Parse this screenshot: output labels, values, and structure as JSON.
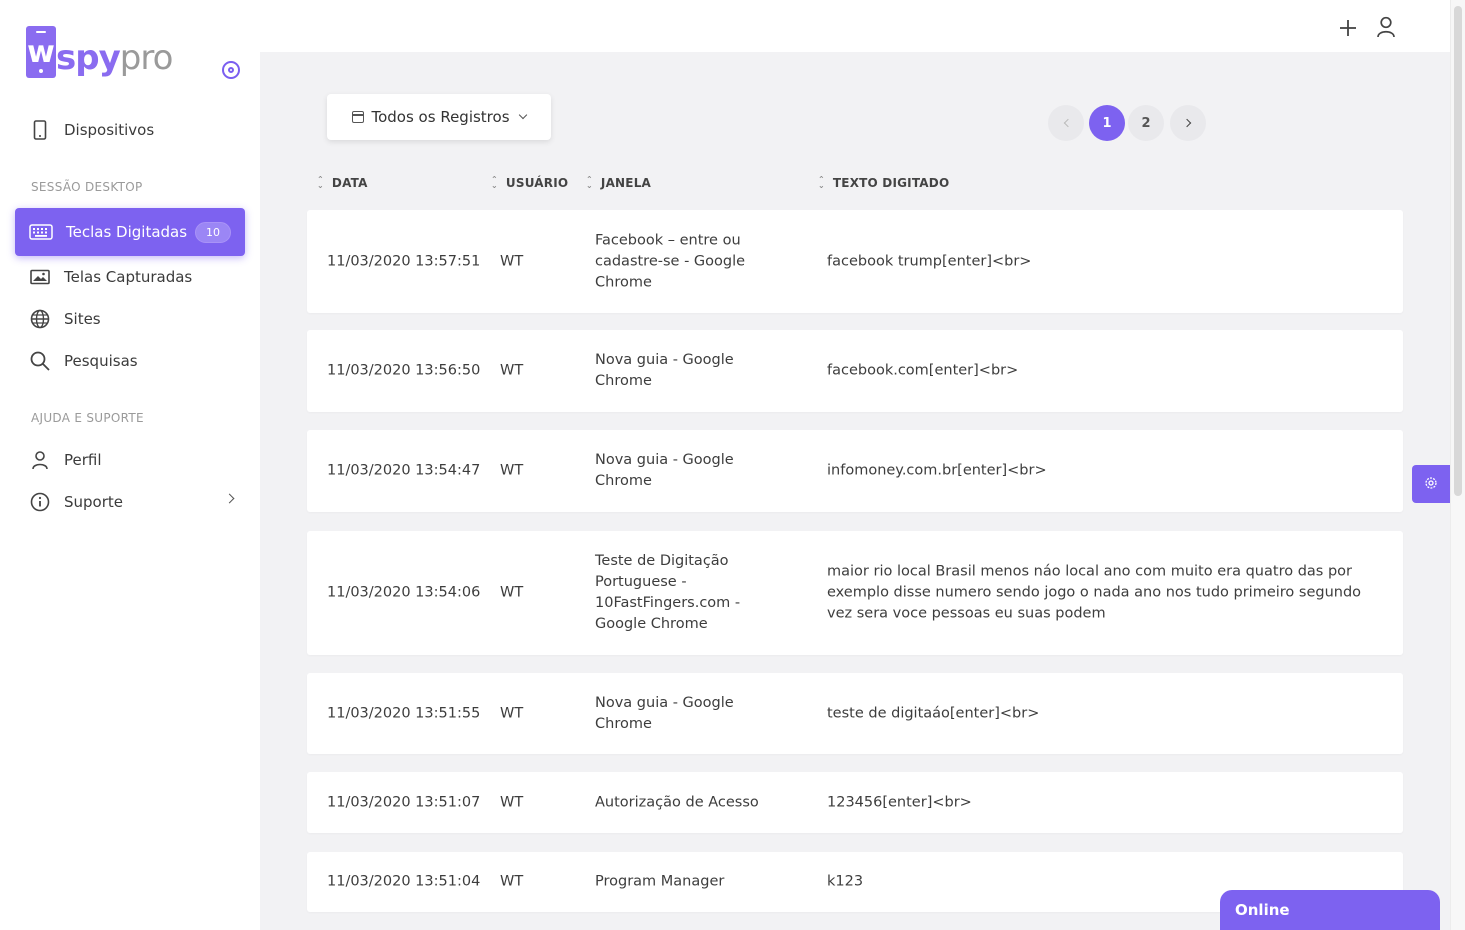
{
  "brand": {
    "mark": "w",
    "spy": "spy",
    "pro": "pro"
  },
  "sidebar": {
    "devices_label": "Dispositivos",
    "section_desktop": "SESSÃO DESKTOP",
    "keystrokes_label": "Teclas Digitadas",
    "keystrokes_count": "10",
    "screens_label": "Telas Capturadas",
    "sites_label": "Sites",
    "searches_label": "Pesquisas",
    "section_help": "AJUDA E SUPORTE",
    "profile_label": "Perfil",
    "support_label": "Suporte"
  },
  "filter": {
    "label": "Todos os Registros"
  },
  "pagination": {
    "pages": [
      "1",
      "2"
    ],
    "current": "1"
  },
  "table": {
    "headers": {
      "date": "DATA",
      "user": "USUÁRIO",
      "window": "JANELA",
      "text": "TEXTO DIGITADO"
    },
    "rows": [
      {
        "date": "11/03/2020 13:57:51",
        "user": "WT",
        "window": "Facebook – entre ou cadastre-se - Google Chrome",
        "text": "facebook trump[enter]<br>"
      },
      {
        "date": "11/03/2020 13:56:50",
        "user": "WT",
        "window": "Nova guia - Google Chrome",
        "text": "facebook.com[enter]<br>"
      },
      {
        "date": "11/03/2020 13:54:47",
        "user": "WT",
        "window": "Nova guia - Google Chrome",
        "text": "infomoney.com.br[enter]<br>"
      },
      {
        "date": "11/03/2020 13:54:06",
        "user": "WT",
        "window": "Teste de Digitação Portuguese - 10FastFingers.com - Google Chrome",
        "text": "maior rio local Brasil menos náo local ano com muito era quatro das por exemplo disse numero sendo jogo o nada ano nos tudo primeiro segundo vez sera voce pessoas eu suas podem"
      },
      {
        "date": "11/03/2020 13:51:55",
        "user": "WT",
        "window": "Nova guia - Google Chrome",
        "text": "teste de digitaáo[enter]<br>"
      },
      {
        "date": "11/03/2020 13:51:07",
        "user": "WT",
        "window": "Autorização de Acesso",
        "text": "123456[enter]<br>"
      },
      {
        "date": "11/03/2020 13:51:04",
        "user": "WT",
        "window": "Program Manager",
        "text": "k123"
      }
    ]
  },
  "chat": {
    "status": "Online"
  },
  "colors": {
    "accent": "#7d62f0"
  }
}
